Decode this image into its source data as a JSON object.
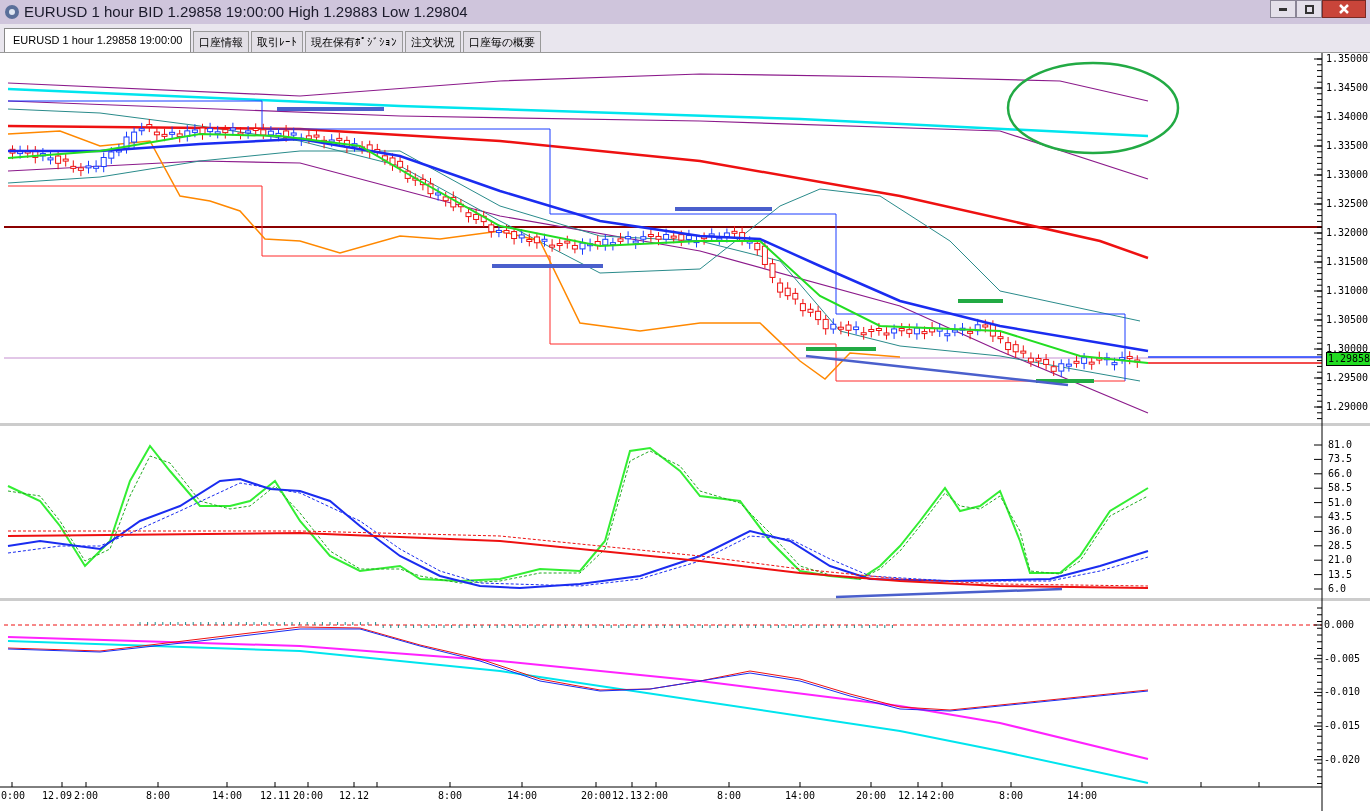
{
  "window": {
    "title": "EURUSD 1 hour BID 1.29858 19:00:00 High 1.29883 Low 1.29804"
  },
  "tabs": [
    {
      "label": "EURUSD 1 hour 1.29858 19:00:00",
      "selected": true
    },
    {
      "label": "口座情報",
      "selected": false
    },
    {
      "label": "取引ﾚｰﾄ",
      "selected": false
    },
    {
      "label": "現在保有ﾎﾟｼﾞｼｮﾝ",
      "selected": false
    },
    {
      "label": "注文状況",
      "selected": false
    },
    {
      "label": "口座毎の概要",
      "selected": false
    }
  ],
  "price_axis": [
    "1.35000",
    "1.34500",
    "1.34000",
    "1.33500",
    "1.33000",
    "1.32500",
    "1.32000",
    "1.31500",
    "1.31000",
    "1.30500",
    "1.30000",
    "1.29500",
    "1.29000"
  ],
  "current_price": "1.29858",
  "oscillator_axis": [
    "81.0",
    "73.5",
    "66.0",
    "58.5",
    "51.0",
    "43.5",
    "36.0",
    "28.5",
    "21.0",
    "13.5",
    "6.0"
  ],
  "macd_axis": [
    "0.000",
    "-0.005",
    "-0.010",
    "-0.015",
    "-0.020"
  ],
  "time_axis": [
    "0:00",
    "12.09",
    "2:00",
    "8:00",
    "14:00",
    "12.11",
    "20:00",
    "12.12",
    "8:00",
    "14:00",
    "20:00",
    "12.13",
    "2:00",
    "8:00",
    "14:00",
    "20:00",
    "12.14",
    "2:00",
    "8:00",
    "14:00"
  ]
}
